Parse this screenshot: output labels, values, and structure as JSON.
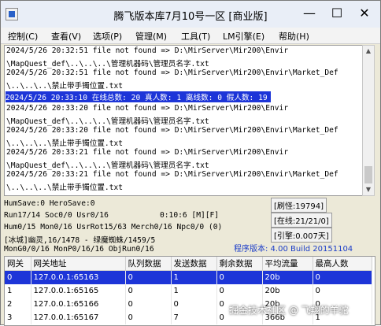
{
  "window": {
    "title": "腾飞版本库7月10号一区 [商业版]",
    "controls": {
      "minimize": "—",
      "maximize": "☐",
      "close": "✕"
    }
  },
  "menu": [
    {
      "label": "控制(C)"
    },
    {
      "label": "查看(V)"
    },
    {
      "label": "选项(P)"
    },
    {
      "label": "管理(M)"
    },
    {
      "label": "工具(T)"
    },
    {
      "label": "LM引擎(E)"
    },
    {
      "label": "帮助(H)"
    }
  ],
  "log": {
    "lines": [
      "2024/5/26 20:32:51 file not found => D:\\MirServer\\Mir200\\Envir",
      "\\MapQuest_def\\..\\..\\..\\管理机器码\\管理员名字.txt",
      "2024/5/26 20:32:51 file not found => D:\\MirServer\\Mir200\\Envir\\Market_Def",
      "\\..\\..\\..\\禁止带手镯位置.txt",
      "2024/5/26 20:33:10 在线总数: 20 真人数: 1 离线数: 0 假人数: 19",
      "2024/5/26 20:33:20 file not found => D:\\MirServer\\Mir200\\Envir",
      "\\MapQuest_def\\..\\..\\..\\管理机器码\\管理员名字.txt",
      "2024/5/26 20:33:20 file not found => D:\\MirServer\\Mir200\\Envir\\Market_Def",
      "\\..\\..\\..\\禁止带手镯位置.txt",
      "2024/5/26 20:33:21 file not found => D:\\MirServer\\Mir200\\Envir",
      "\\MapQuest_def\\..\\..\\..\\管理机器码\\管理员名字.txt",
      "2024/5/26 20:33:21 file not found => D:\\MirServer\\Mir200\\Envir\\Market_Def",
      "\\..\\..\\..\\禁止带手镯位置.txt"
    ],
    "selected_index": 4
  },
  "status": {
    "humsave": "HumSave:0 HeroSave:0",
    "run": "Run17/14 Soc0/0 Usr0/16",
    "timer": "0:10:6 [M][F]",
    "hum": "Hum0/15 Mon0/16 UsrRot15/63 Merch0/16 Npc0/0 (0)",
    "monster": "[冰城]幽灵,16/1478 - 绿魔蜘蛛/1459/5",
    "mongo": "MonG0/0/16 MonP0/16/16 ObjRun0/16",
    "refresh": "[刷怪:19794]",
    "online": "[在线:21/21/0]",
    "engine": "[引擎:0.007天]",
    "version": "程序版本: 4.00 Build 20151104"
  },
  "table": {
    "headers": [
      "网关",
      "网关地址",
      "队列数据",
      "发送数据",
      "剩余数据",
      "平均流量",
      "最高人数"
    ],
    "rows": [
      [
        "0",
        "127.0.0.1:65163",
        "0",
        "1",
        "0",
        "20b",
        "0"
      ],
      [
        "1",
        "127.0.0.1:65165",
        "0",
        "1",
        "0",
        "20b",
        "0"
      ],
      [
        "2",
        "127.0.0.1:65166",
        "0",
        "0",
        "0",
        "20b",
        "0"
      ],
      [
        "3",
        "127.0.0.1:65167",
        "0",
        "7",
        "0",
        "366b",
        "1"
      ]
    ],
    "selected_row": 0
  },
  "watermark": "掘金技术社区 @ 飞翔的羊驼",
  "colors": {
    "selection": "#1d35d8",
    "version_text": "#1a3cc8"
  }
}
